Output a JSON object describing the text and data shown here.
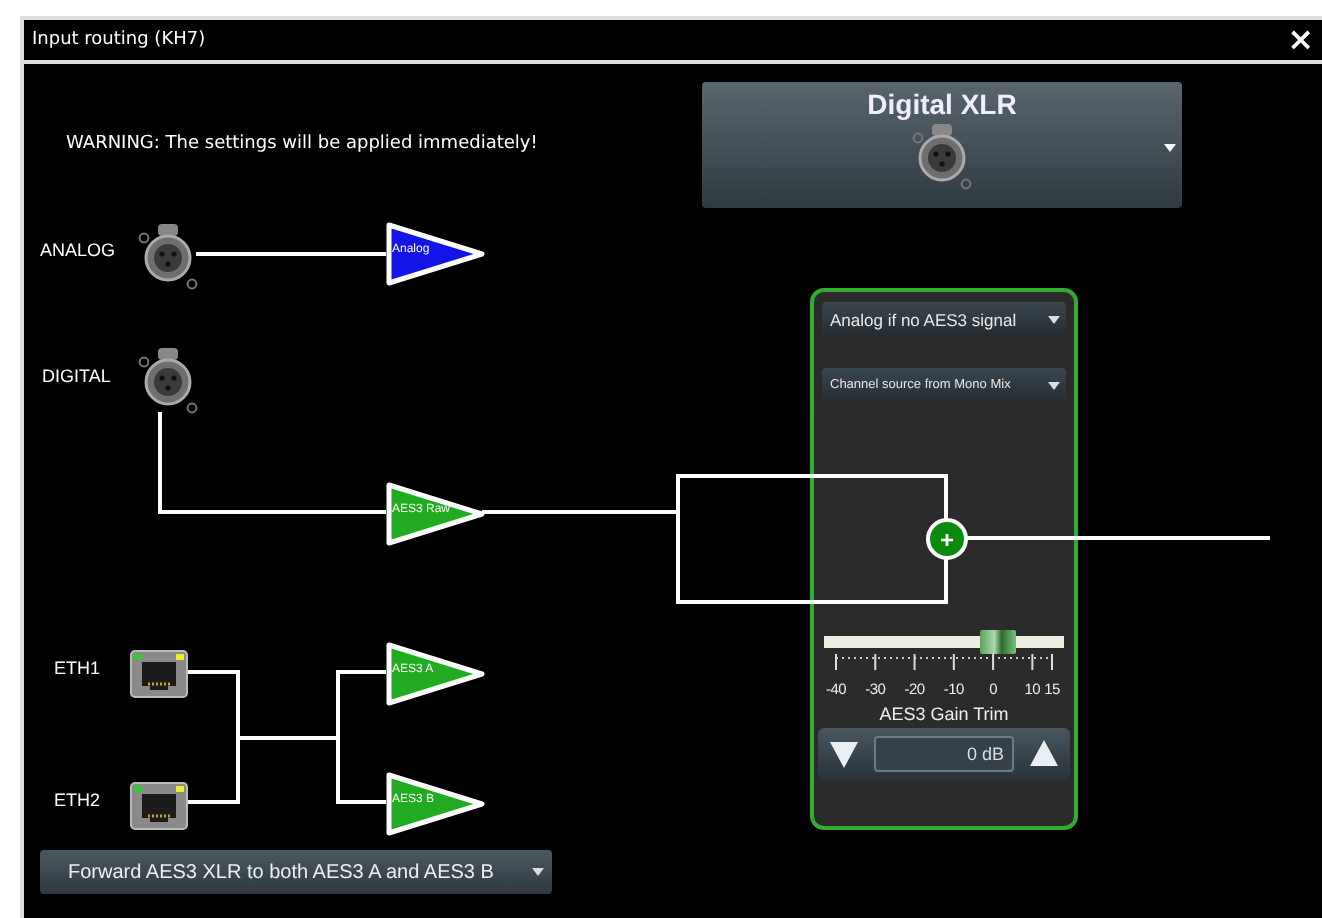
{
  "window": {
    "title": "Input routing (KH7)",
    "close": "×"
  },
  "warning": "WARNING: The settings will be applied immediately!",
  "input_select": {
    "value": "Digital XLR"
  },
  "inputs": [
    {
      "label": "ANALOG",
      "kind": "xlr"
    },
    {
      "label": "DIGITAL",
      "kind": "xlr"
    },
    {
      "label": "ETH1",
      "kind": "ethernet"
    },
    {
      "label": "ETH2",
      "kind": "ethernet"
    }
  ],
  "stages": [
    {
      "label": "Analog",
      "color": "#1414e6"
    },
    {
      "label": "AES3 Raw",
      "color": "#22aa22"
    },
    {
      "label": "AES3 A",
      "color": "#22aa22"
    },
    {
      "label": "AES3 B",
      "color": "#22aa22"
    }
  ],
  "panel": {
    "mode_select": "Analog if no AES3 signal",
    "source_select": "Channel source from Mono Mix",
    "mix_symbol": "+",
    "gain": {
      "level": 0.727,
      "ticks": [
        "-40",
        "-30",
        "-20",
        "-10",
        "0",
        "10",
        "15"
      ],
      "label": "AES3 Gain Trim",
      "value": "0 dB"
    }
  },
  "forward_select": "Forward AES3 XLR to both AES3 A and AES3 B"
}
